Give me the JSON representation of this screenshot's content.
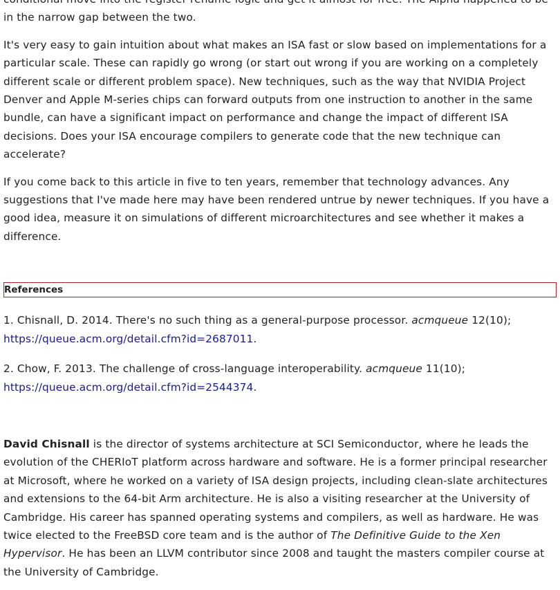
{
  "paragraphs": {
    "p0": "conditional move into the register rename logic and get it almost for free. The Alpha happened to be in the narrow gap between the two.",
    "p1": "It's very easy to gain intuition about what makes an ISA fast or slow based on implementations for a particular scale. These can rapidly go wrong (or start out wrong if you are working on a completely different scale or different problem space). New techniques, such as the way that NVIDIA Project Denver and Apple M-series chips can forward outputs from one instruction to another in the same bundle, can have a significant impact on performance and change the impact of different ISA decisions. Does your ISA encourage compilers to generate code that the new technique can accelerate?",
    "p2": "If you come back to this article in five to ten years, remember that technology advances. Any suggestions that I've made here may have been rendered untrue by newer techniques. If you have a good idea, measure it on simulations of different microarchitectures and see whether it makes a difference."
  },
  "references": {
    "heading": "References",
    "items": [
      {
        "prefix": "1. Chisnall, D. 2014. There's no such thing as a general-purpose processor. ",
        "journal": "acmqueue",
        "suffix": " 12(10);",
        "url": "https://queue.acm.org/detail.cfm?id=2687011",
        "end": "."
      },
      {
        "prefix": "2. Chow, F. 2013. The challenge of cross-language interoperability. ",
        "journal": "acmqueue",
        "suffix": " 11(10);",
        "url": "https://queue.acm.org/detail.cfm?id=2544374",
        "end": "."
      }
    ]
  },
  "bio": {
    "name": "David Chisnall",
    "text1": " is the director of systems architecture at SCI Semiconductor, where he leads the evolution of the CHERIoT platform across hardware and software. He is a former principal researcher at Microsoft, where he worked on a variety of ISA design projects, including clean-slate architectures and extensions to the 64-bit Arm architecture. He is also a visiting researcher at the University of Cambridge. His career has spanned operating systems and compilers, as well as hardware. He was twice elected to the FreeBSD core team and is the author of ",
    "book": "The Definitive Guide to the Xen Hypervisor",
    "text2": ". He has been an LLVM contributor since 2008 and taught the masters compiler course at the University of Cambridge."
  }
}
